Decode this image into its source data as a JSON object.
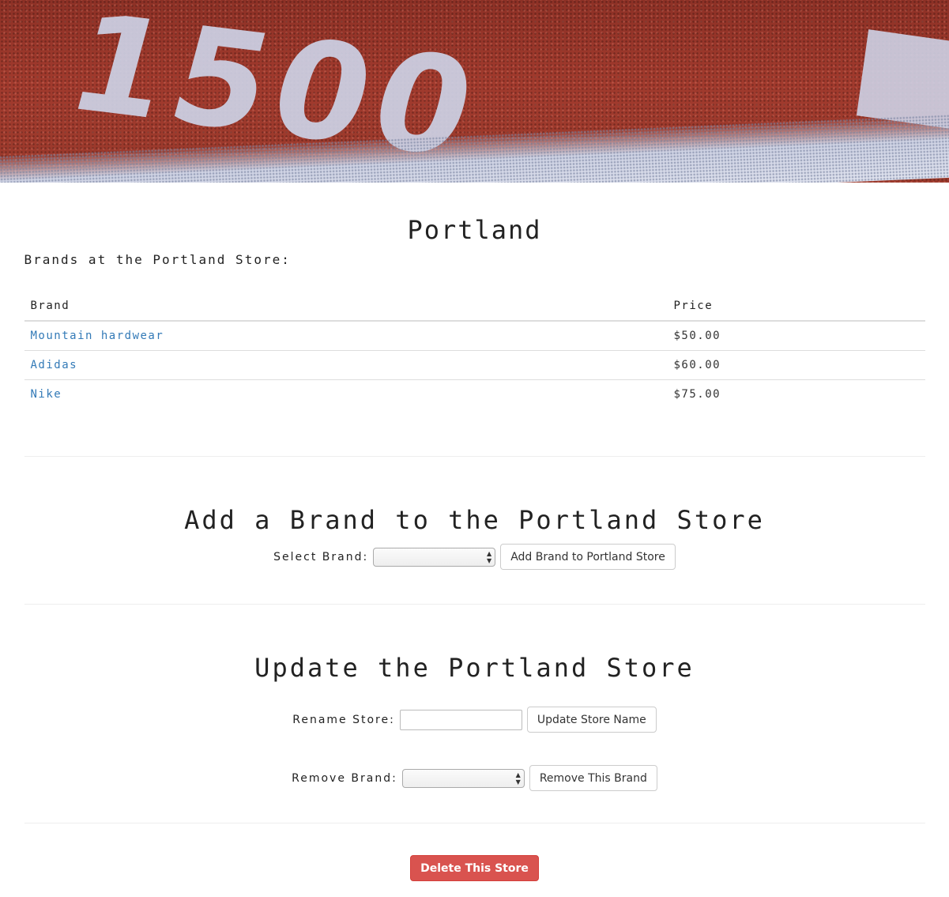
{
  "hero": {
    "image_text": "1500"
  },
  "store": {
    "title": "Portland",
    "subtitle": "Brands at the Portland Store:"
  },
  "brands_table": {
    "headers": [
      "Brand",
      "Price"
    ],
    "rows": [
      {
        "brand": "Mountain hardwear",
        "price": "$50.00"
      },
      {
        "brand": "Adidas",
        "price": "$60.00"
      },
      {
        "brand": "Nike",
        "price": "$75.00"
      }
    ]
  },
  "add_brand": {
    "title": "Add a Brand to the Portland Store",
    "select_label": "Select Brand:",
    "select_value": "",
    "button_label": "Add Brand to Portland Store"
  },
  "update_store": {
    "title": "Update the Portland Store",
    "rename_label": "Rename Store:",
    "rename_value": "",
    "rename_button": "Update Store Name",
    "remove_label": "Remove Brand:",
    "remove_value": "",
    "remove_button": "Remove This Brand"
  },
  "delete": {
    "button_label": "Delete This Store"
  },
  "colors": {
    "link": "#337ab7",
    "danger": "#d9534f",
    "track": "#9a392c"
  },
  "icons": {
    "select_arrows": "chevron-up-down-icon"
  }
}
